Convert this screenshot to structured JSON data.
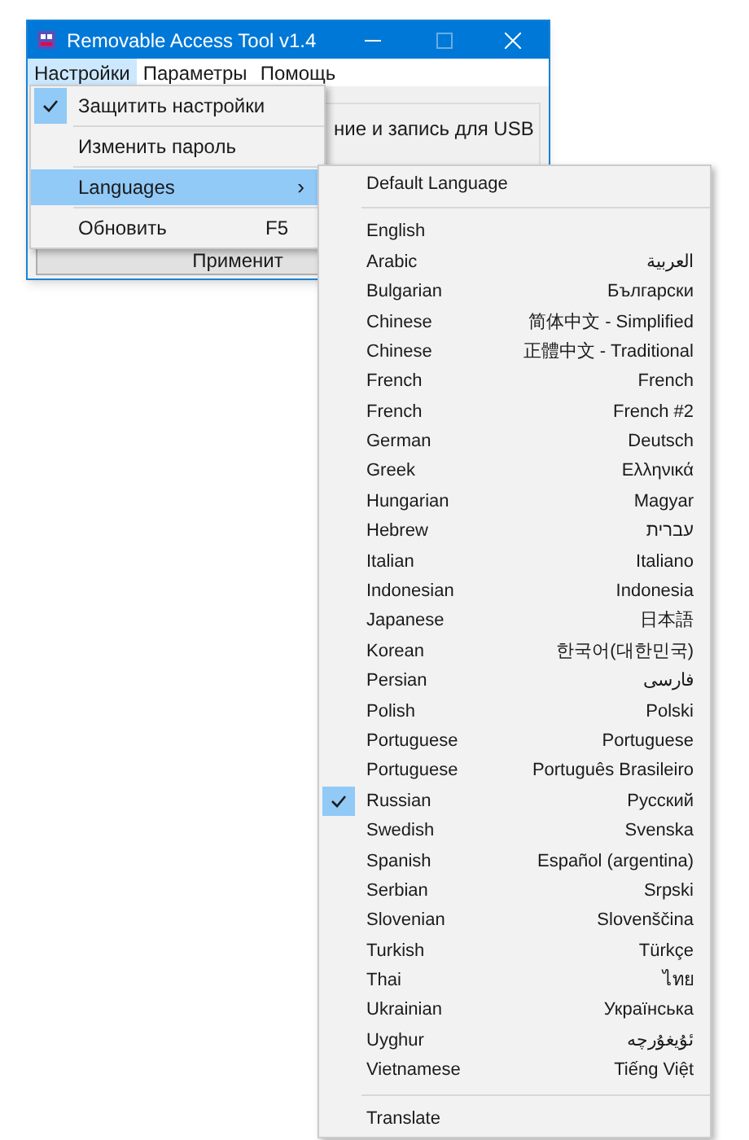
{
  "window": {
    "title": "Removable Access Tool v1.4",
    "active": true
  },
  "menu_bar": [
    {
      "label": "Настройки",
      "selected": true
    },
    {
      "label": "Параметры",
      "selected": false
    },
    {
      "label": "Помощь",
      "selected": false
    }
  ],
  "background": {
    "group_text": "ние и запись для USB",
    "button_label": "Применит"
  },
  "dropdown": [
    {
      "kind": "item",
      "label": "Защитить настройки",
      "checked": true,
      "selected": false
    },
    {
      "kind": "separator"
    },
    {
      "kind": "item",
      "label": "Изменить пароль",
      "checked": false,
      "selected": false
    },
    {
      "kind": "separator"
    },
    {
      "kind": "item",
      "label": "Languages",
      "arrow": "›",
      "checked": false,
      "selected": true
    },
    {
      "kind": "separator"
    },
    {
      "kind": "item",
      "label": "Обновить",
      "shortcut": "F5",
      "checked": false,
      "selected": false
    }
  ],
  "languages_menu": [
    {
      "kind": "item",
      "label": "Default Language",
      "checked": false
    },
    {
      "kind": "separator"
    },
    {
      "kind": "item",
      "label": "English",
      "checked": false
    },
    {
      "kind": "item",
      "label": "Arabic",
      "native": "العربية",
      "checked": false
    },
    {
      "kind": "item",
      "label": "Bulgarian",
      "native": "Български",
      "checked": false
    },
    {
      "kind": "item",
      "label": "Chinese",
      "native": "简体中文 - Simplified",
      "checked": false
    },
    {
      "kind": "item",
      "label": "Chinese",
      "native": "正體中文 - Traditional",
      "checked": false
    },
    {
      "kind": "item",
      "label": "French",
      "native": "French",
      "checked": false
    },
    {
      "kind": "item",
      "label": "French",
      "native": "French #2",
      "checked": false
    },
    {
      "kind": "item",
      "label": "German",
      "native": "Deutsch",
      "checked": false
    },
    {
      "kind": "item",
      "label": "Greek",
      "native": "Ελληνικά",
      "checked": false
    },
    {
      "kind": "item",
      "label": "Hungarian",
      "native": "Magyar",
      "checked": false
    },
    {
      "kind": "item",
      "label": "Hebrew",
      "native": "עברית",
      "checked": false
    },
    {
      "kind": "item",
      "label": "Italian",
      "native": "Italiano",
      "checked": false
    },
    {
      "kind": "item",
      "label": "Indonesian",
      "native": "Indonesia",
      "checked": false
    },
    {
      "kind": "item",
      "label": "Japanese",
      "native": "日本語",
      "checked": false
    },
    {
      "kind": "item",
      "label": "Korean",
      "native": "한국어(대한민국)",
      "checked": false
    },
    {
      "kind": "item",
      "label": "Persian",
      "native": "فارسی",
      "checked": false
    },
    {
      "kind": "item",
      "label": "Polish",
      "native": "Polski",
      "checked": false
    },
    {
      "kind": "item",
      "label": "Portuguese",
      "native": "Portuguese",
      "checked": false
    },
    {
      "kind": "item",
      "label": "Portuguese",
      "native": "Português Brasileiro",
      "checked": false
    },
    {
      "kind": "item",
      "label": "Russian",
      "native": "Русский",
      "checked": true
    },
    {
      "kind": "item",
      "label": "Swedish",
      "native": "Svenska",
      "checked": false
    },
    {
      "kind": "item",
      "label": "Spanish",
      "native": "Español (argentina)",
      "checked": false
    },
    {
      "kind": "item",
      "label": "Serbian",
      "native": "Srpski",
      "checked": false
    },
    {
      "kind": "item",
      "label": "Slovenian",
      "native": "Slovenščina",
      "checked": false
    },
    {
      "kind": "item",
      "label": "Turkish",
      "native": "Türkçe",
      "checked": false
    },
    {
      "kind": "item",
      "label": "Thai",
      "native": "ไทย",
      "checked": false
    },
    {
      "kind": "item",
      "label": "Ukrainian",
      "native": "Українська",
      "checked": false
    },
    {
      "kind": "item",
      "label": "Uyghur",
      "native": "ئۇيغۇرچە",
      "checked": false
    },
    {
      "kind": "item",
      "label": "Vietnamese",
      "native": "Tiếng Việt",
      "checked": false
    },
    {
      "kind": "separator"
    },
    {
      "kind": "item",
      "label": "Translate",
      "checked": false
    }
  ]
}
